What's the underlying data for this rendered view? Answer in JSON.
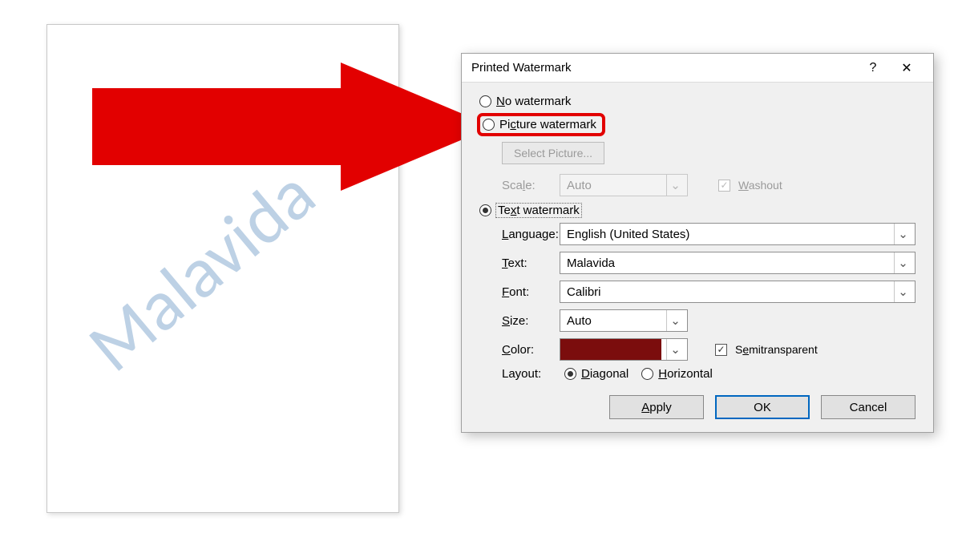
{
  "document": {
    "watermark_text": "Malavida"
  },
  "dialog": {
    "title": "Printed Watermark",
    "help_symbol": "?",
    "close_symbol": "✕",
    "radios": {
      "no_watermark": "No watermark",
      "picture_watermark": "Picture watermark",
      "text_watermark": "Text watermark"
    },
    "select_picture_btn": "Select Picture...",
    "scale_label": "Scale:",
    "scale_value": "Auto",
    "washout_label": "Washout",
    "language_label": "Language:",
    "language_value": "English (United States)",
    "text_label": "Text:",
    "text_value": "Malavida",
    "font_label": "Font:",
    "font_value": "Calibri",
    "size_label": "Size:",
    "size_value": "Auto",
    "color_label": "Color:",
    "color_value": "#7b0d0d",
    "semitransparent_label": "Semitransparent",
    "layout_label": "Layout:",
    "layout_diagonal": "Diagonal",
    "layout_horizontal": "Horizontal",
    "buttons": {
      "apply": "Apply",
      "ok": "OK",
      "cancel": "Cancel"
    }
  }
}
